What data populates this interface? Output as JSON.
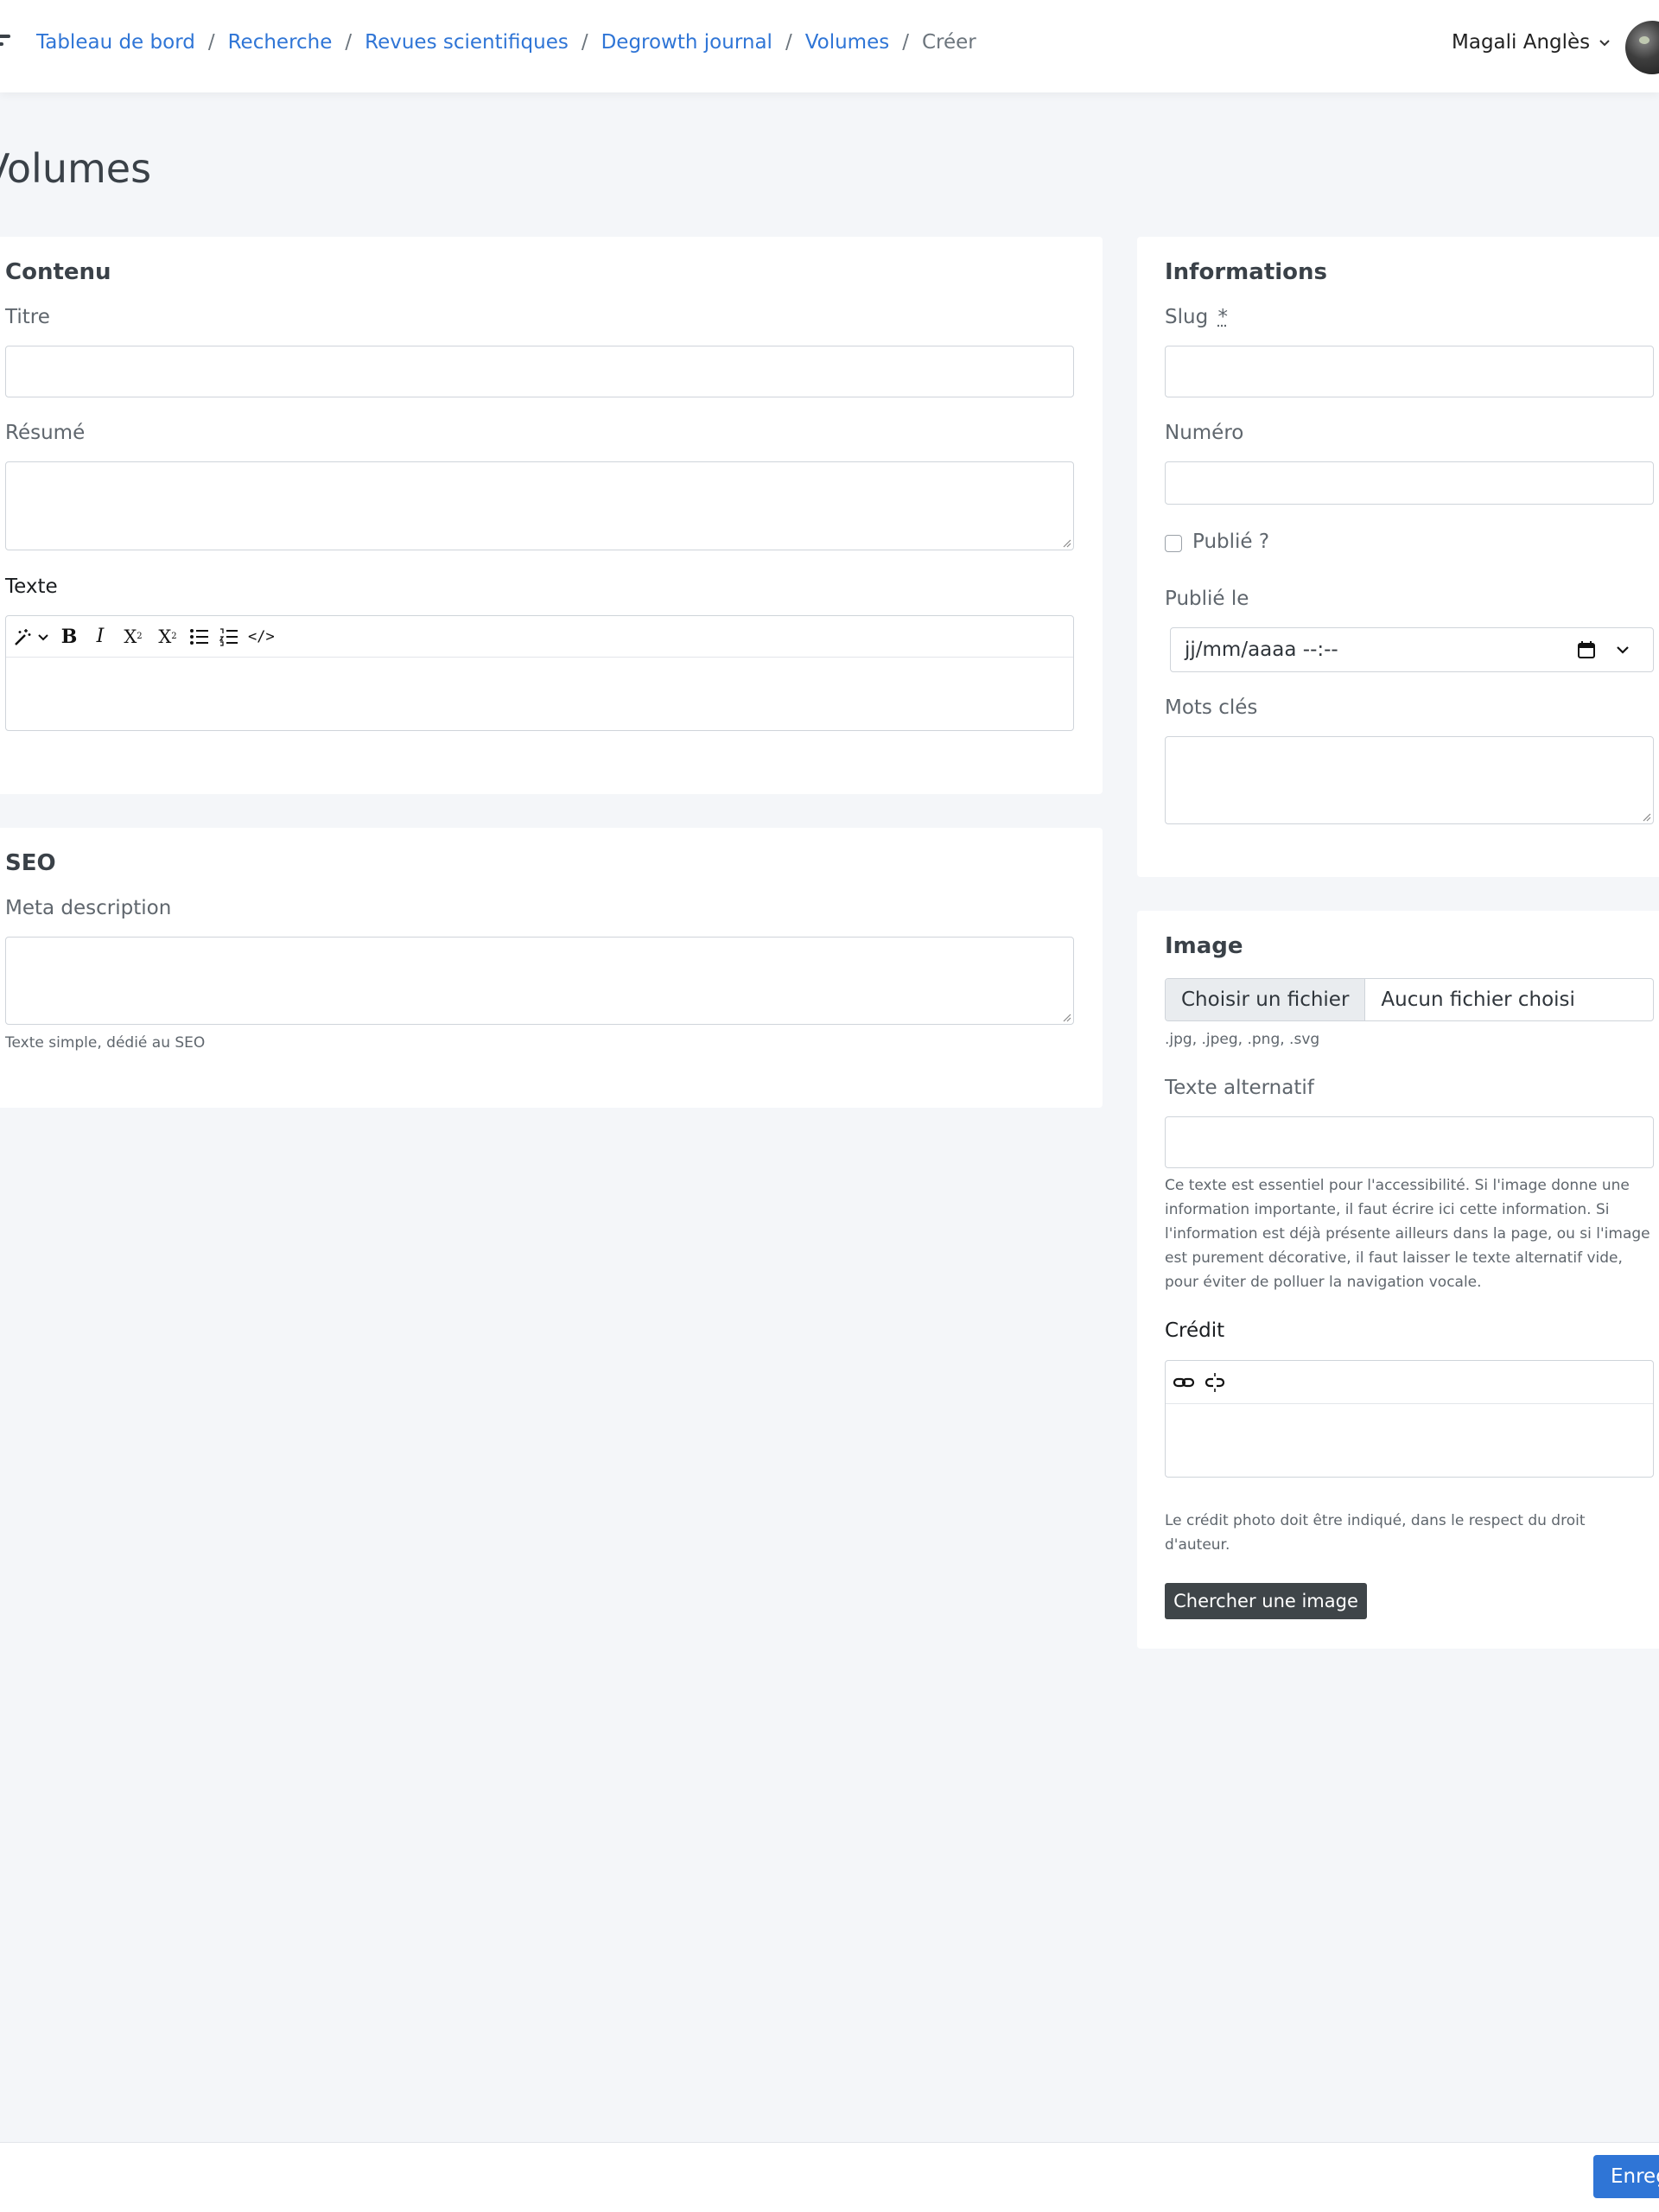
{
  "breadcrumb": {
    "items": [
      "Tableau de bord",
      "Recherche",
      "Revues scientifiques",
      "Degrowth journal",
      "Volumes"
    ],
    "current": "Créer",
    "separator": "/"
  },
  "user": {
    "name": "Magali Anglès"
  },
  "page": {
    "title": "Volumes"
  },
  "content_card": {
    "title": "Contenu",
    "title_label": "Titre",
    "summary_label": "Résumé",
    "text_label": "Texte"
  },
  "seo_card": {
    "title": "SEO",
    "meta_label": "Meta description",
    "meta_help": "Texte simple, dédié au SEO"
  },
  "info_card": {
    "title": "Informations",
    "slug_label": "Slug",
    "slug_required": "*",
    "number_label": "Numéro",
    "published_label": "Publié ?",
    "published_on_label": "Publié le",
    "date_placeholder": "jj/mm/aaaa --:--",
    "keywords_label": "Mots clés"
  },
  "image_card": {
    "title": "Image",
    "file_button": "Choisir un fichier",
    "file_none": "Aucun fichier choisi",
    "file_types": ".jpg, .jpeg, .png, .svg",
    "alt_label": "Texte alternatif",
    "alt_help": "Ce texte est essentiel pour l'accessibilité. Si l'image donne une information importante, il faut écrire ici cette information. Si l'information est déjà présente ailleurs dans la page, ou si l'image est purement décorative, il faut laisser le texte alternatif vide, pour éviter de polluer la navigation vocale.",
    "credit_label": "Crédit",
    "credit_help": "Le crédit photo doit être indiqué, dans le respect du droit d'auteur.",
    "search_button": "Chercher une image"
  },
  "footer": {
    "save_label": "Enregistrer"
  },
  "colors": {
    "accent": "#2f75d6",
    "background": "#f4f6f9",
    "dark_button": "#3f4549"
  }
}
